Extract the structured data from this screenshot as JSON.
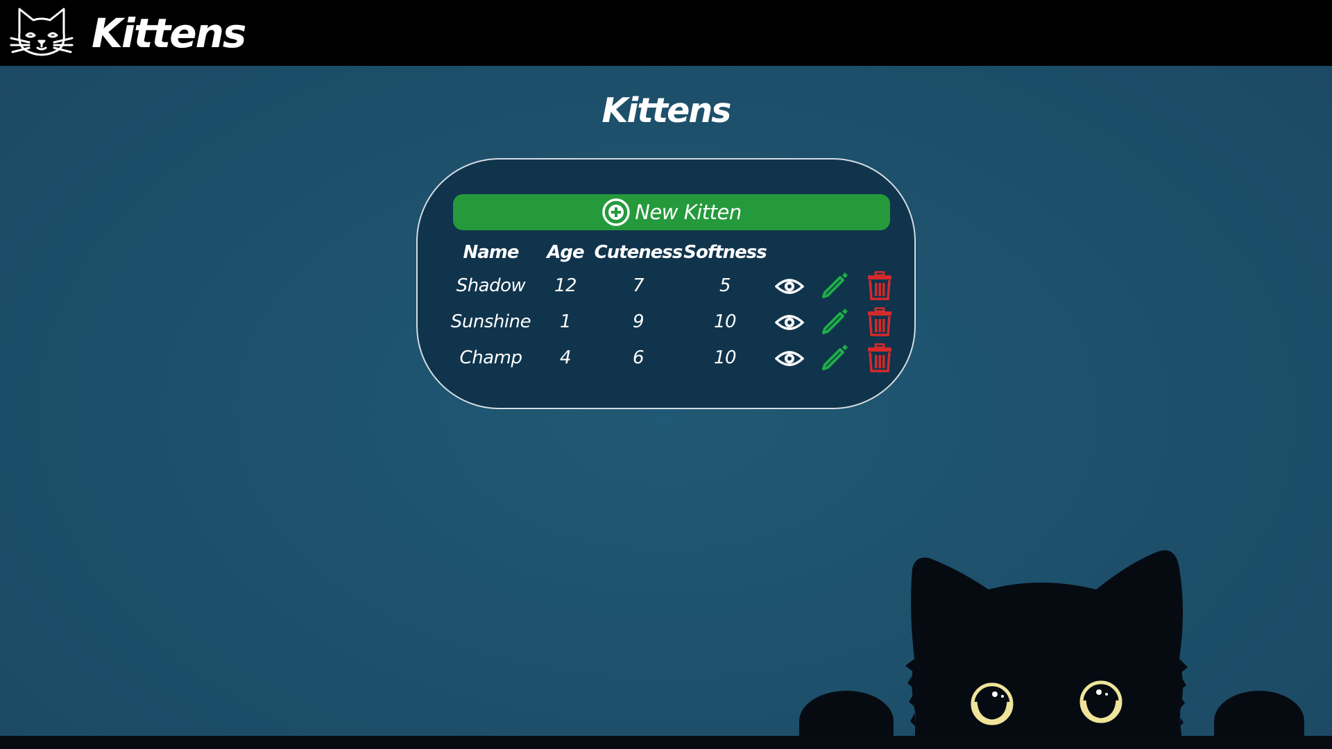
{
  "navbar": {
    "brand": "Kittens",
    "logo_icon": "cat-head-icon"
  },
  "page": {
    "title": "Kittens"
  },
  "actions": {
    "new_label": "New Kitten",
    "new_icon": "plus-circle-icon"
  },
  "table": {
    "headers": {
      "name": "Name",
      "age": "Age",
      "cuteness": "Cuteness",
      "softness": "Softness"
    },
    "rows": [
      {
        "name": "Shadow",
        "age": "12",
        "cuteness": "7",
        "softness": "5"
      },
      {
        "name": "Sunshine",
        "age": "1",
        "cuteness": "9",
        "softness": "10"
      },
      {
        "name": "Champ",
        "age": "4",
        "cuteness": "6",
        "softness": "10"
      }
    ],
    "row_action_icons": [
      "eye-icon",
      "pencil-icon",
      "trash-icon"
    ]
  },
  "colors": {
    "navbar": "#000000",
    "background": "#1d4f6a",
    "card": "#10344c",
    "accent_green": "#259a3c",
    "edit_green": "#1fae47",
    "delete_red": "#d42a2a"
  }
}
